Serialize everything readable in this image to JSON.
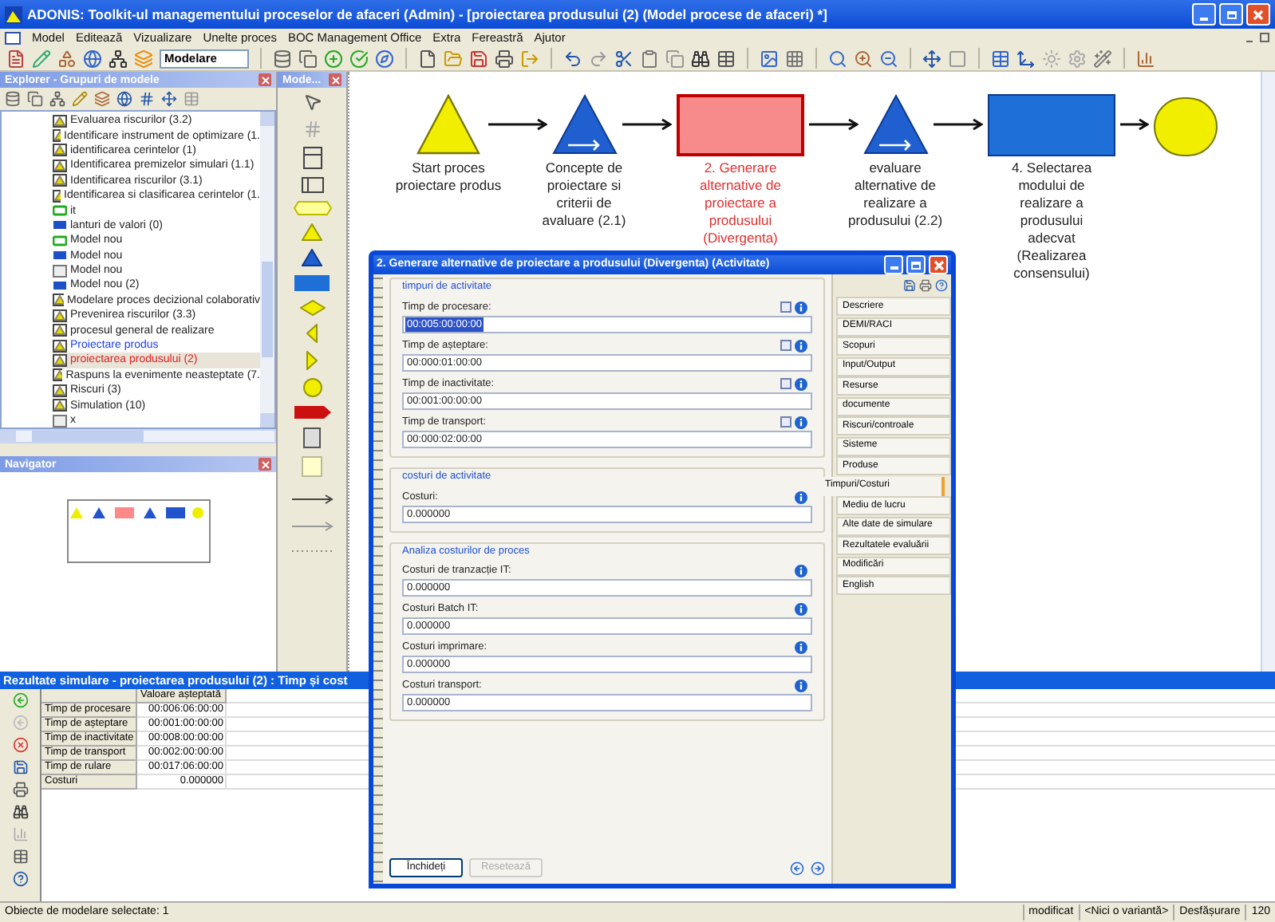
{
  "window": {
    "title": "ADONIS: Toolkit-ul managementului proceselor de afaceri (Admin) - [proiectarea produsului (2) (Model procese de afaceri) *]"
  },
  "menu": [
    "Model",
    "Editează",
    "Vizualizare",
    "Unelte proces",
    "BOC Management Office",
    "Extra",
    "Fereastră",
    "Ajutor"
  ],
  "toolbar": {
    "mode": "Modelare"
  },
  "explorer": {
    "title": "Explorer - Grupuri de modele",
    "items": [
      {
        "label": "Evaluarea riscurilor (3.2)",
        "kind": "process",
        "selected": false,
        "color": "#222222"
      },
      {
        "label": "Identificare instrument de optimizare (1.",
        "kind": "process",
        "selected": false,
        "color": "#222222"
      },
      {
        "label": "identificarea cerintelor (1)",
        "kind": "process",
        "selected": false,
        "color": "#222222"
      },
      {
        "label": "Identificarea premizelor simulari (1.1)",
        "kind": "process",
        "selected": false,
        "color": "#222222"
      },
      {
        "label": "Identificarea riscurilor (3.1)",
        "kind": "process",
        "selected": false,
        "color": "#222222"
      },
      {
        "label": "Identificarea si clasificarea cerintelor (1.",
        "kind": "process",
        "selected": false,
        "color": "#222222"
      },
      {
        "label": "it",
        "kind": "green",
        "selected": false,
        "color": "#222222"
      },
      {
        "label": "lanturi de valori (0)",
        "kind": "blue",
        "selected": false,
        "color": "#222222"
      },
      {
        "label": "Model nou",
        "kind": "green",
        "selected": false,
        "color": "#222222"
      },
      {
        "label": "Model nou",
        "kind": "blue",
        "selected": false,
        "color": "#222222"
      },
      {
        "label": "Model nou",
        "kind": "gray",
        "selected": false,
        "color": "#222222"
      },
      {
        "label": "Model nou (2)",
        "kind": "blue",
        "selected": false,
        "color": "#222222"
      },
      {
        "label": "Modelare proces decizional colaborativ",
        "kind": "process",
        "selected": false,
        "color": "#222222"
      },
      {
        "label": "Prevenirea riscurilor (3.3)",
        "kind": "process",
        "selected": false,
        "color": "#222222"
      },
      {
        "label": "procesul general de realizare",
        "kind": "process",
        "selected": false,
        "color": "#222222"
      },
      {
        "label": "Proiectare produs",
        "kind": "process",
        "selected": false,
        "color": "#2040f0"
      },
      {
        "label": "proiectarea produsului (2)",
        "kind": "process",
        "selected": true,
        "color": "#e02020"
      },
      {
        "label": "Raspuns la evenimente neasteptate (7.",
        "kind": "process",
        "selected": false,
        "color": "#222222"
      },
      {
        "label": "Riscuri (3)",
        "kind": "process",
        "selected": false,
        "color": "#222222"
      },
      {
        "label": "Simulation (10)",
        "kind": "process",
        "selected": false,
        "color": "#222222"
      },
      {
        "label": "x",
        "kind": "gray",
        "selected": false,
        "color": "#222222"
      }
    ]
  },
  "palette": {
    "title": "Mode..."
  },
  "navigator": {
    "title": "Navigator"
  },
  "diagram": {
    "nodes": [
      {
        "kind": "start",
        "label": "Start proces\nproiectare produs",
        "selected": false
      },
      {
        "kind": "subprocess",
        "label": "Concepte de\nproiectare si\ncriterii de\navaluare (2.1)",
        "selected": false
      },
      {
        "kind": "activity",
        "label": "2. Generare\nalternative de\nproiectare a\nprodusului\n(Divergenta)",
        "selected": true
      },
      {
        "kind": "subprocess",
        "label": "evaluare\nalternative de\nrealizare a\nprodusului (2.2)",
        "selected": false
      },
      {
        "kind": "activity",
        "label": "4. Selectarea\nmodului de\nrealizare a\nprodusului\nadecvat\n(Realizarea\nconsensului)",
        "selected": false
      },
      {
        "kind": "end"
      }
    ]
  },
  "dialog": {
    "title": "2. Generare alternative de proiectare a produsului (Divergenta) (Activitate)",
    "sections": [
      {
        "title": "timpuri de activitate",
        "fields": [
          {
            "label": "Timp de procesare:",
            "value": "00:005:00:00:00",
            "kind": "time",
            "selected": true,
            "checked": false
          },
          {
            "label": "Timp de așteptare:",
            "value": "00:000:01:00:00",
            "kind": "time",
            "selected": false,
            "checked": false
          },
          {
            "label": "Timp de inactivitate:",
            "value": "00:001:00:00:00",
            "kind": "time",
            "selected": false,
            "checked": false
          },
          {
            "label": "Timp de transport:",
            "value": "00:000:02:00:00",
            "kind": "time",
            "selected": false,
            "checked": false
          }
        ]
      },
      {
        "title": "costuri de activitate",
        "fields": [
          {
            "label": "Costuri:",
            "value": "0.000000",
            "kind": "cost",
            "selected": false
          }
        ]
      },
      {
        "title": "Analiza costurilor de proces",
        "fields": [
          {
            "label": "Costuri de tranzacție IT:",
            "value": "0.000000",
            "kind": "cost",
            "selected": false
          },
          {
            "label": "Costuri Batch IT:",
            "value": "0.000000",
            "kind": "cost",
            "selected": false
          },
          {
            "label": "Costuri imprimare:",
            "value": "0.000000",
            "kind": "cost",
            "selected": false
          },
          {
            "label": "Costuri transport:",
            "value": "0.000000",
            "kind": "cost",
            "selected": false
          }
        ]
      }
    ],
    "tabs": [
      {
        "label": "Descriere",
        "selected": false
      },
      {
        "label": "DEMI/RACI",
        "selected": false
      },
      {
        "label": "Scopuri",
        "selected": false
      },
      {
        "label": "Input/Output",
        "selected": false
      },
      {
        "label": "Resurse",
        "selected": false
      },
      {
        "label": "documente",
        "selected": false
      },
      {
        "label": "Riscuri/controale",
        "selected": false
      },
      {
        "label": "Sisteme",
        "selected": false
      },
      {
        "label": "Produse",
        "selected": false
      },
      {
        "label": "Timpuri/Costuri",
        "selected": true
      },
      {
        "label": "Mediu de lucru",
        "selected": false
      },
      {
        "label": "Alte date de simulare",
        "selected": false
      },
      {
        "label": "Rezultatele evaluării",
        "selected": false
      },
      {
        "label": "Modificări",
        "selected": false
      },
      {
        "label": "English",
        "selected": false
      }
    ],
    "buttons": [
      {
        "label": "Închideți",
        "disabled": false
      },
      {
        "label": "Resetează",
        "disabled": true
      }
    ]
  },
  "results": {
    "title": "Rezultate simulare - proiectarea produsului (2) : Timp și cost",
    "column": "Valoare așteptată",
    "rows": [
      {
        "label": "Timp de procesare",
        "value": "00:006:06:00:00"
      },
      {
        "label": "Timp de așteptare",
        "value": "00:001:00:00:00"
      },
      {
        "label": "Timp de inactivitate",
        "value": "00:008:00:00:00"
      },
      {
        "label": "Timp de transport",
        "value": "00:002:00:00:00"
      },
      {
        "label": "Timp de rulare",
        "value": "00:017:06:00:00"
      },
      {
        "label": "Costuri",
        "value": "0.000000"
      }
    ]
  },
  "status_bar": {
    "message": "Obiecte de modelare selectate: 1",
    "cells": [
      "modificat",
      "<Nici o variantă>",
      "Desfășurare",
      "120"
    ]
  }
}
